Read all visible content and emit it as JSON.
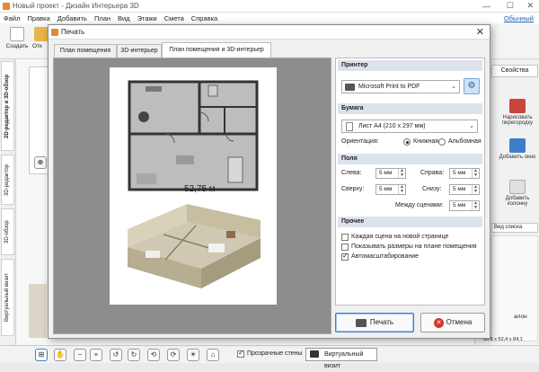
{
  "window": {
    "title": "Новый проект - Дизайн Интерьера 3D",
    "login_link": "Обычный"
  },
  "menu": [
    "Файл",
    "Правка",
    "Добавить",
    "План",
    "Вид",
    "Этажи",
    "Смета",
    "Справка"
  ],
  "toolbar": {
    "create_label": "Создать",
    "open_label": "Отк"
  },
  "sidebar_tabs": [
    "2D-редактор и 3D-обзор",
    "3D-редактор",
    "3D-обзор",
    "Виртуальный визит"
  ],
  "right_panel": {
    "properties_tab": "Свойства",
    "items": [
      "Нарисовать перегородку",
      "Добавить окно",
      "Добавить колонну"
    ],
    "list_header": "Вид списка",
    "list_fragments": [
      "алон",
      "60,8 x 52,4 x 84,1"
    ]
  },
  "bottom_bar": {
    "transparent_walls_label": "Прозрачные стены",
    "transparent_walls_checked": true,
    "virtual_visit_label": "Виртуальный визит"
  },
  "dialog": {
    "title": "Печать",
    "tabs": [
      "План помещения",
      "3D-интерьер",
      "План помещения и 3D-интерьер"
    ],
    "active_tab_index": 2,
    "preview": {
      "area_label": "52,75 м"
    },
    "printer": {
      "section": "Принтер",
      "selected": "Microsoft Print to PDF"
    },
    "paper": {
      "section": "Бумага",
      "selected": "Лист А4 (210 x 297 мм)",
      "orientation_label": "Ориентация:",
      "orientation_options": [
        "Книжная",
        "Альбомная"
      ],
      "orientation_selected": "Книжная"
    },
    "margins": {
      "section": "Поля",
      "left_label": "Слева:",
      "left_value": "5 мм",
      "right_label": "Справа:",
      "right_value": "5 мм",
      "top_label": "Сверху:",
      "top_value": "5 мм",
      "bottom_label": "Снизу:",
      "bottom_value": "5 мм",
      "between_label": "Между сценами:",
      "between_value": "5 мм"
    },
    "other": {
      "section": "Прочее",
      "options": [
        {
          "label": "Каждая сцена на новой странице",
          "checked": false
        },
        {
          "label": "Показывать размеры на плане помещения",
          "checked": false
        },
        {
          "label": "Автомасштабирование",
          "checked": true
        }
      ]
    },
    "print_button": "Печать",
    "cancel_button": "Отмена"
  }
}
